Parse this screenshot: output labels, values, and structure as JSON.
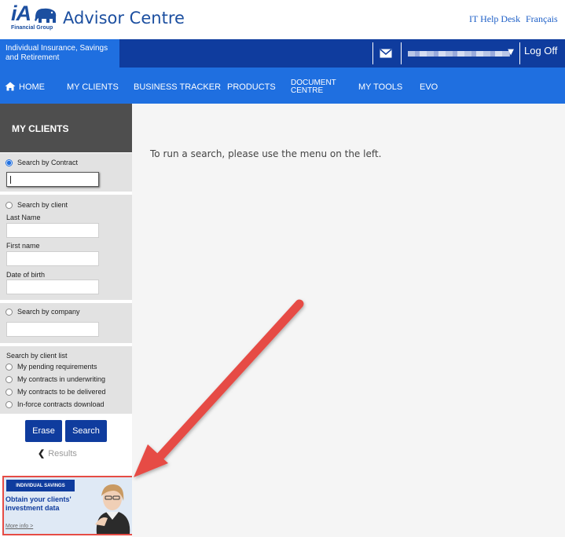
{
  "header": {
    "logo_text": "iA",
    "logo_subtitle": "Financial Group",
    "site_title": "Advisor Centre",
    "help_link": "IT Help Desk",
    "language_link": "Français"
  },
  "topbar": {
    "section_label": "Individual Insurance, Savings and Retirement",
    "mail_icon": "envelope-icon",
    "user_dropdown_icon": "caret-down-icon",
    "logoff_label": "Log Off"
  },
  "nav": {
    "home_icon": "home-icon",
    "items": [
      "HOME",
      "MY CLIENTS",
      "BUSINESS TRACKER",
      "PRODUCTS",
      "DOCUMENT CENTRE",
      "MY TOOLS",
      "EVO"
    ],
    "document_line1": "DOCUMENT",
    "document_line2": "CENTRE"
  },
  "sidebar": {
    "title": "MY CLIENTS",
    "contract": {
      "label": "Search by Contract",
      "value": ""
    },
    "client": {
      "label": "Search by client",
      "last_name_label": "Last Name",
      "first_name_label": "First name",
      "dob_label": "Date of birth"
    },
    "company": {
      "label": "Search by company"
    },
    "client_list": {
      "title": "Search by client list",
      "options": [
        "My pending requirements",
        "My contracts in underwriting",
        "My contracts to be delivered",
        "In-force contracts download"
      ]
    },
    "erase_label": "Erase",
    "search_label": "Search",
    "results_label": "Results",
    "results_icon": "chevron-left-icon"
  },
  "ad": {
    "tag": "INDIVIDUAL SAVINGS",
    "headline": "Obtain your clients' investment data",
    "more": "More info >"
  },
  "main": {
    "message": "To run a search, please use the menu on the left."
  },
  "colors": {
    "dark_blue": "#0f3c9e",
    "bright_blue": "#1f6fe0",
    "annotation_red": "#e64c45",
    "sidebar_header": "#4e4e4e"
  }
}
